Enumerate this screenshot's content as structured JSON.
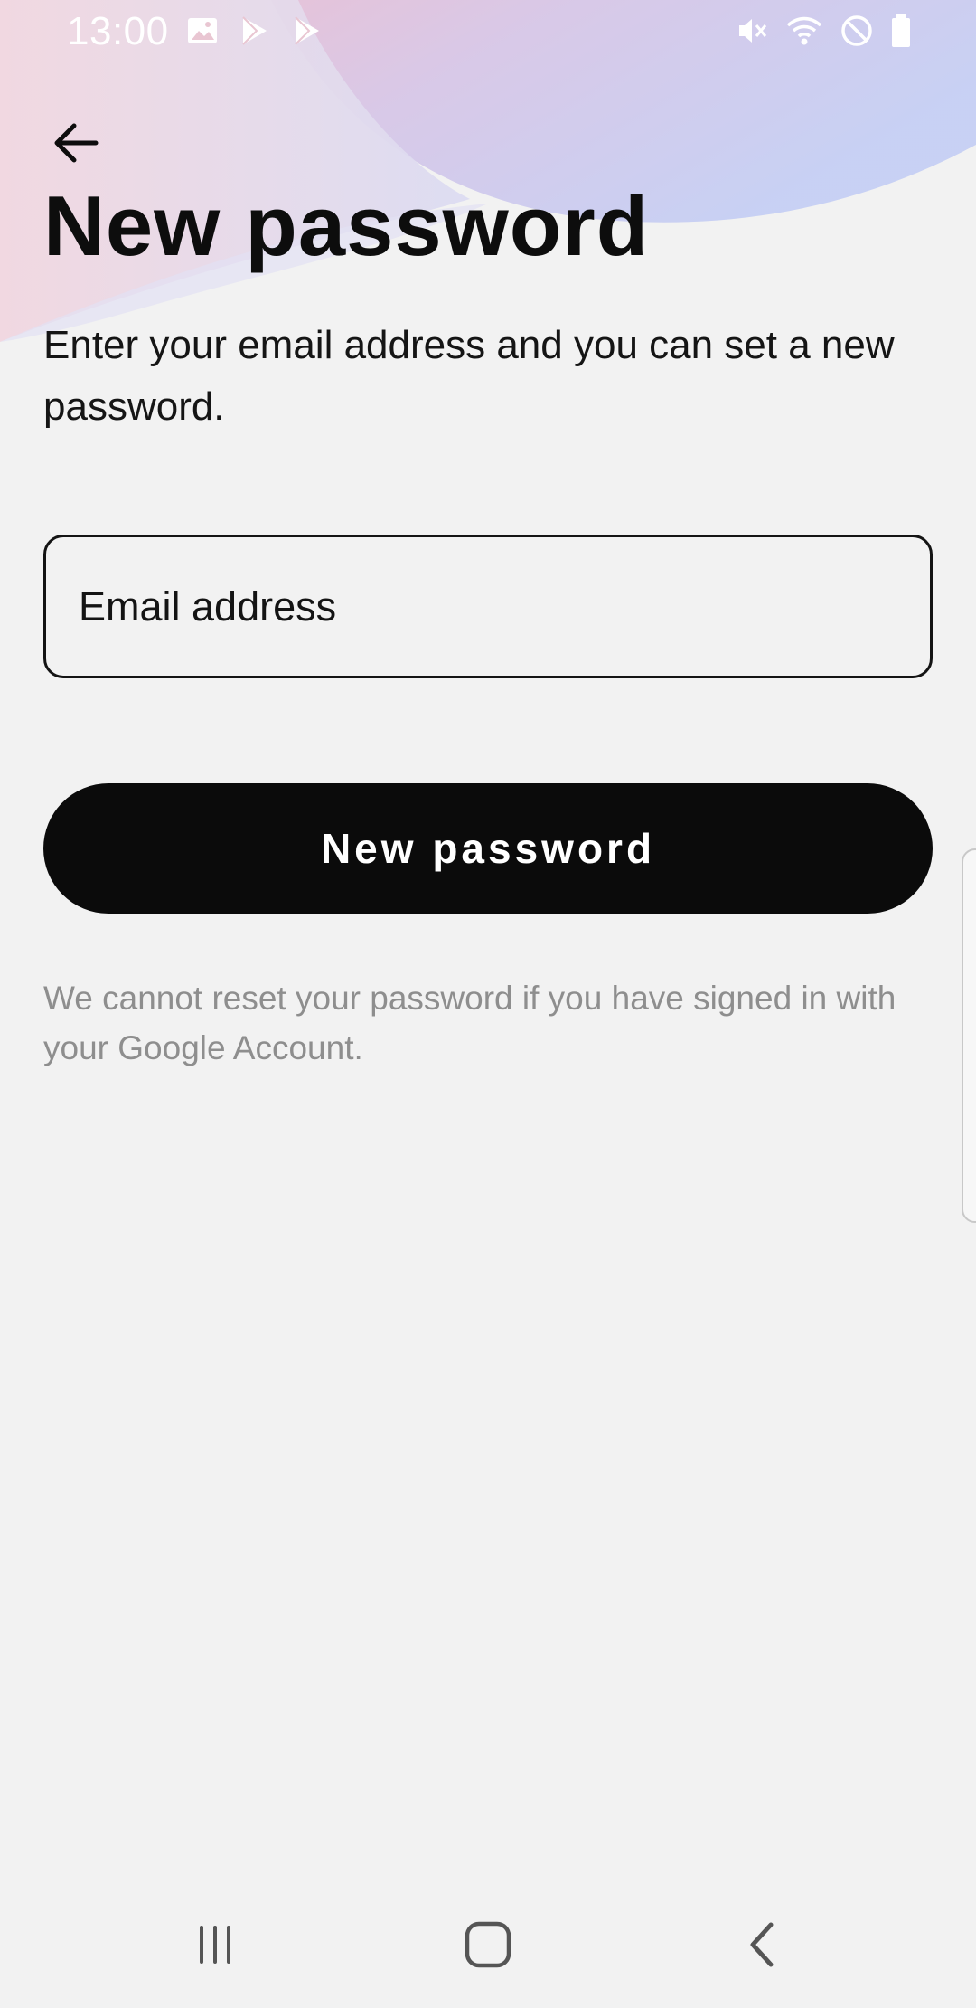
{
  "status_bar": {
    "time": "13:00",
    "left_icons": [
      "image-icon",
      "play-store-icon",
      "play-store-icon"
    ],
    "right_icons": [
      "vibrate-icon",
      "wifi-icon",
      "do-not-disturb-icon",
      "battery-icon"
    ]
  },
  "header": {
    "back_icon": "arrow-left-icon",
    "title": "New password",
    "subtitle": "Enter your email address and you can set a new password."
  },
  "form": {
    "email_placeholder": "Email address",
    "email_value": "",
    "submit_label": "New password"
  },
  "note": "We cannot reset your password if you have signed in with your Google Account.",
  "nav_bar": {
    "items": [
      "recent-apps-icon",
      "home-icon",
      "back-icon"
    ]
  },
  "colors": {
    "background": "#f2f2f2",
    "text": "#0d0d0d",
    "button": "#0b0b0b",
    "note_text": "#8e8e8e",
    "gradient_pink": "#f1b8c8",
    "gradient_blue": "#c3cdf4"
  }
}
